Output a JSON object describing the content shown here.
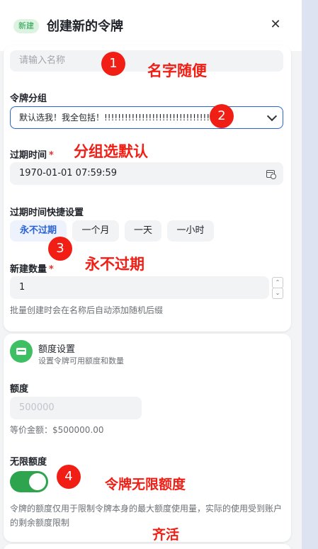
{
  "header": {
    "badge": "新建",
    "title": "创建新的令牌",
    "close_icon": "✕"
  },
  "form": {
    "name_placeholder": "请输入名称",
    "group_label": "令牌分组",
    "group_value": "默认选我！我全包括！!!!!!!!!!!!!!!!!!!!!!!!!!!!!!!!!!",
    "expire_label": "过期时间",
    "expire_required": "*",
    "expire_value": "1970-01-01 07:59:59",
    "quick_label": "过期时间快捷设置",
    "quick_options": [
      "永不过期",
      "一个月",
      "一天",
      "一小时"
    ],
    "count_label": "新建数量",
    "count_required": "*",
    "count_value": "1",
    "count_hint": "批量创建时会在名称后自动添加随机后缀"
  },
  "quota": {
    "section_title": "额度设置",
    "section_sub": "设置令牌可用额度和数量",
    "amount_label": "额度",
    "amount_placeholder": "500000",
    "equivalent": "等价金额：$500000.00",
    "unlimited_label": "无限额度",
    "unlimited_on": true,
    "note": "令牌的额度仅用于限制令牌本身的最大额度使用量，实际的使用受到账户的剩余额度限制"
  },
  "annotations": [
    {
      "num": "1",
      "text": "名字随便"
    },
    {
      "num": "2",
      "text": "分组选默认"
    },
    {
      "num": "3",
      "text": "永不过期"
    },
    {
      "num": "4",
      "text": "令牌无限额度"
    },
    {
      "text": "齐活"
    }
  ],
  "colors": {
    "accent": "#2a63d4",
    "toggle_on": "#2ea44f",
    "annotation": "#f01e14"
  }
}
